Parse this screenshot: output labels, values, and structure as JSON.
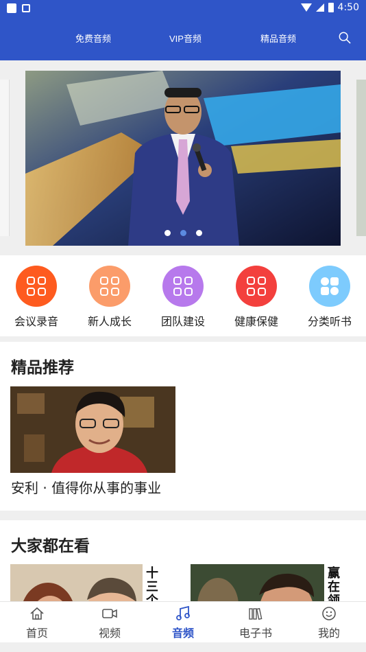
{
  "status_bar": {
    "time": "4:50"
  },
  "top_nav": {
    "tabs": [
      "免费音频",
      "VIP音频",
      "精品音频"
    ],
    "search_icon": "search-icon"
  },
  "banner": {
    "dots": 3,
    "active_dot": 2
  },
  "categories": [
    {
      "label": "会议录音",
      "color": "#fe5b1f",
      "icon": "grid-icon"
    },
    {
      "label": "新人成长",
      "color": "#fb9c6a",
      "icon": "grid-icon"
    },
    {
      "label": "团队建设",
      "color": "#b779ec",
      "icon": "grid-icon"
    },
    {
      "label": "健康保健",
      "color": "#f3403d",
      "icon": "grid-icon"
    },
    {
      "label": "分类听书",
      "color": "#7dcbfd",
      "icon": "category-icon"
    }
  ],
  "featured": {
    "title": "精品推荐",
    "item_title": "安利 · 值得你从事的事业"
  },
  "popular": {
    "title": "大家都在看",
    "items": [
      {
        "side_text": "十三个"
      },
      {
        "side_text": "赢在领"
      }
    ]
  },
  "bottom_nav": {
    "items": [
      {
        "label": "首页",
        "icon": "home-icon"
      },
      {
        "label": "视频",
        "icon": "video-icon"
      },
      {
        "label": "音频",
        "icon": "music-icon",
        "active": true
      },
      {
        "label": "电子书",
        "icon": "books-icon"
      },
      {
        "label": "我的",
        "icon": "face-icon"
      }
    ]
  },
  "colors": {
    "primary": "#2f55c8",
    "background": "#efefef"
  }
}
